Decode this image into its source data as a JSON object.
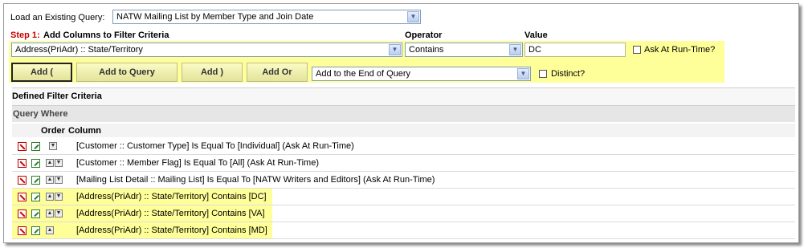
{
  "load_query": {
    "label": "Load an Existing Query:",
    "selected": "NATW Mailing List by Member Type and Join Date"
  },
  "step1": {
    "prefix": "Step 1:",
    "title": "Add Columns to Filter Criteria",
    "operator_header": "Operator",
    "value_header": "Value",
    "column_selected": "Address(PriAdr) :: State/Territory",
    "operator_selected": "Contains",
    "value": "DC",
    "ask_runtime_label": "Ask At Run-Time?"
  },
  "buttons": {
    "add_paren": "Add (",
    "add_to_query": "Add to Query",
    "add_close_paren": "Add )",
    "add_or": "Add Or"
  },
  "position_select": "Add to the End of Query",
  "distinct_label": "Distinct?",
  "defined": {
    "title": "Defined Filter Criteria",
    "query_where": "Query Where",
    "col_order": "Order",
    "col_column": "Column"
  },
  "rows": [
    {
      "text": "[Customer :: Customer Type] Is Equal To [Individual] (Ask At Run-Time)",
      "order": "down"
    },
    {
      "text": "[Customer :: Member Flag] Is Equal To [All] (Ask At Run-Time)",
      "order": "updown"
    },
    {
      "text": "[Mailing List Detail :: Mailing List] Is Equal To [NATW Writers and Editors] (Ask At Run-Time)",
      "order": "updown"
    },
    {
      "text": "[Address(PriAdr) :: State/Territory] Contains [DC]",
      "order": "updown"
    },
    {
      "text": "[Address(PriAdr) :: State/Territory] Contains [VA]",
      "order": "updown"
    },
    {
      "text": "[Address(PriAdr) :: State/Territory] Contains [MD]",
      "order": "up"
    }
  ],
  "colors": {
    "highlight": "#ffff99",
    "step_red": "#cc0000",
    "header_gray": "#e6e6e6"
  }
}
